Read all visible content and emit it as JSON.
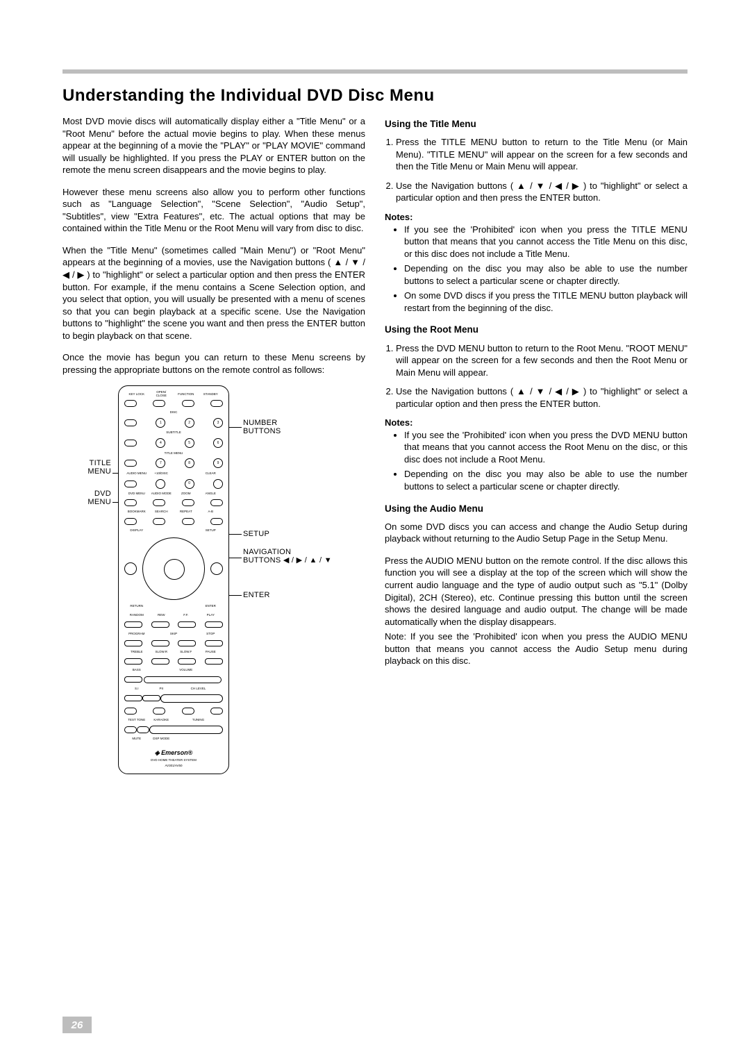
{
  "pageNumber": "26",
  "title": "Understanding the Individual DVD Disc Menu",
  "intro": {
    "p1": "Most DVD movie discs will automatically display either a \"Title Menu\" or a \"Root Menu\" before the actual movie begins to play. When these menus appear at the beginning of a movie the \"PLAY\" or \"PLAY MOVIE\" command will usually be highlighted. If you press the PLAY or ENTER button on the remote the menu screen disappears and the movie begins to play.",
    "p2": "However these menu screens also allow you to perform other functions such as \"Language Selection\", \"Scene Selection\", \"Audio Setup\", \"Subtitles\", view \"Extra Features\", etc. The actual options that may be contained within the Title Menu or the Root Menu will vary from disc to disc.",
    "p3": "When the \"Title Menu\" (sometimes called \"Main Menu\") or \"Root Menu\" appears at the beginning of a movies, use the Navigation buttons ( ▲ / ▼ / ◀ / ▶ ) to \"highlight\" or select a particular option and then press the ENTER button. For example, if the menu contains a Scene Selection option, and you select that option, you will usually be presented with a menu of scenes so that you can begin playback at a specific scene. Use the Navigation buttons to \"highlight\" the scene you want and then press the ENTER button to begin playback on that scene.",
    "p4": "Once the movie has begun you can return to these Menu screens by pressing the appropriate buttons on the remote control as follows:"
  },
  "remoteCallouts": {
    "titleMenu": "TITLE\nMENU",
    "dvdMenu": "DVD\nMENU",
    "numberButtons": "NUMBER\nBUTTONS",
    "setup": "SETUP",
    "navButtons": "NAVIGATION\nBUTTONS ◀ / ▶ / ▲ / ▼",
    "enter": "ENTER"
  },
  "remoteBrand": "Emerson",
  "remoteBrandSub": "DVD HOME THEATER SYSTEM",
  "titleMenuSection": {
    "heading": "Using the Title Menu",
    "step1": "Press the TITLE MENU button to return to the Title Menu (or Main Menu). \"TITLE MENU\" will appear on the screen for a few seconds and then the Title Menu or Main Menu will appear.",
    "step2": "Use the Navigation buttons ( ▲ / ▼ / ◀ / ▶ ) to \"highlight\" or select a particular option and then press the ENTER button.",
    "notesLabel": "Notes:",
    "notes": [
      "If you see the 'Prohibited' icon when you press the TITLE MENU button that means that you cannot access the Title Menu on this disc, or this disc does not include a Title Menu.",
      "Depending on the disc you may also be able to use the number buttons to select a particular scene or chapter directly.",
      "On some DVD discs if you press the TITLE MENU button playback will restart from the beginning of the disc."
    ]
  },
  "rootMenuSection": {
    "heading": "Using the Root Menu",
    "step1": "Press the DVD MENU button to return to the Root Menu. \"ROOT MENU\" will appear on the screen for a few seconds and then the Root Menu or Main Menu will appear.",
    "step2": "Use the Navigation buttons ( ▲ / ▼ / ◀ / ▶ ) to \"highlight\" or select a particular option and then press the ENTER button.",
    "notesLabel": "Notes:",
    "notes": [
      "If you see the 'Prohibited' icon when you press the DVD MENU button that means that you cannot access the Root Menu on the disc, or this disc does not include a Root Menu.",
      "Depending on the disc you may also be able to use the number buttons to select a particular scene or chapter directly."
    ]
  },
  "audioMenuSection": {
    "heading": "Using the Audio Menu",
    "p1": "On some DVD discs you can access and change the Audio Setup during playback without returning to the Audio Setup Page in the Setup Menu.",
    "p2": "Press the AUDIO MENU button on the remote control. If the disc allows this function you will see a display at the top of the screen which will show the current audio language and the type of audio output such as \"5.1\" (Dolby Digital), 2CH (Stereo), etc. Continue pressing this button until the screen shows the desired language and audio output. The change will be made automatically when the display disappears.",
    "note": "Note: If you see the 'Prohibited' icon when you press the AUDIO MENU button that means you cannot access the Audio Setup menu during playback on this disc."
  }
}
